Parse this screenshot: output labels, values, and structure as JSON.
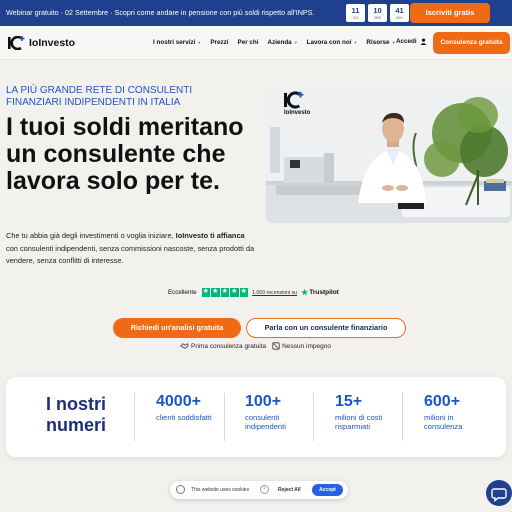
{
  "promo_bar": {
    "text": "Webinar gratuito · 02 Settembre · Scopri come andare in pensione con più soldi rispetto all'INPS.",
    "countdown": [
      {
        "value": "11",
        "label": "GG"
      },
      {
        "value": "10",
        "label": "ORE"
      },
      {
        "value": "41",
        "label": "MIN"
      }
    ],
    "cta": "Iscriviti gratis"
  },
  "nav": {
    "brand": "IoInvesto",
    "links": [
      {
        "label": "I nostri servizi",
        "dropdown": true
      },
      {
        "label": "Prezzi",
        "dropdown": false
      },
      {
        "label": "Per chi",
        "dropdown": false
      },
      {
        "label": "Azienda",
        "dropdown": true
      },
      {
        "label": "Lavora con noi",
        "dropdown": true
      },
      {
        "label": "Risorse",
        "dropdown": true
      }
    ],
    "login": "Accedi",
    "cta": "Consulenza gratuita"
  },
  "hero": {
    "kicker": "LA PIÙ GRANDE RETE DI CONSULENTI FINANZIARI INDIPENDENTI IN ITALIA",
    "headline": "I tuoi soldi meritano un consulente che lavora solo per te.",
    "intro_1": "Che tu abbia già degli investimenti o voglia iniziare, ",
    "intro_bold": "IoInvesto ti affianca",
    "intro_2": " con consulenti indipendenti, senza commissioni nascoste, senza prodotti da vendere, senza conflitti di interesse.",
    "video_logo": "IoInvesto"
  },
  "rating": {
    "label": "Eccellente",
    "stars": 5,
    "reviews": "1.069 recensioni su",
    "platform": "Trustpilot"
  },
  "actions": {
    "primary": "Richiedi un'analisi gratuita",
    "secondary": "Parla con un consulente finanziario",
    "perk_1": "Prima consulenza gratuita",
    "perk_2": "Nessun impegno"
  },
  "numbers": {
    "title": "I nostri numeri",
    "stats": [
      {
        "value": "4000+",
        "label": "clienti soddisfatti"
      },
      {
        "value": "100+",
        "label": "consulenti indipendenti"
      },
      {
        "value": "15+",
        "label": "milioni di costi risparmiati"
      },
      {
        "value": "600+",
        "label": "milioni in consulenza"
      }
    ]
  },
  "cookie": {
    "text": "This website uses cookies",
    "reject": "Reject All",
    "accept": "Accept"
  },
  "colors": {
    "brand_blue": "#1f3f8f",
    "accent_orange": "#f06a15",
    "link_blue": "#1d55c4",
    "trustpilot_green": "#00b67a"
  }
}
